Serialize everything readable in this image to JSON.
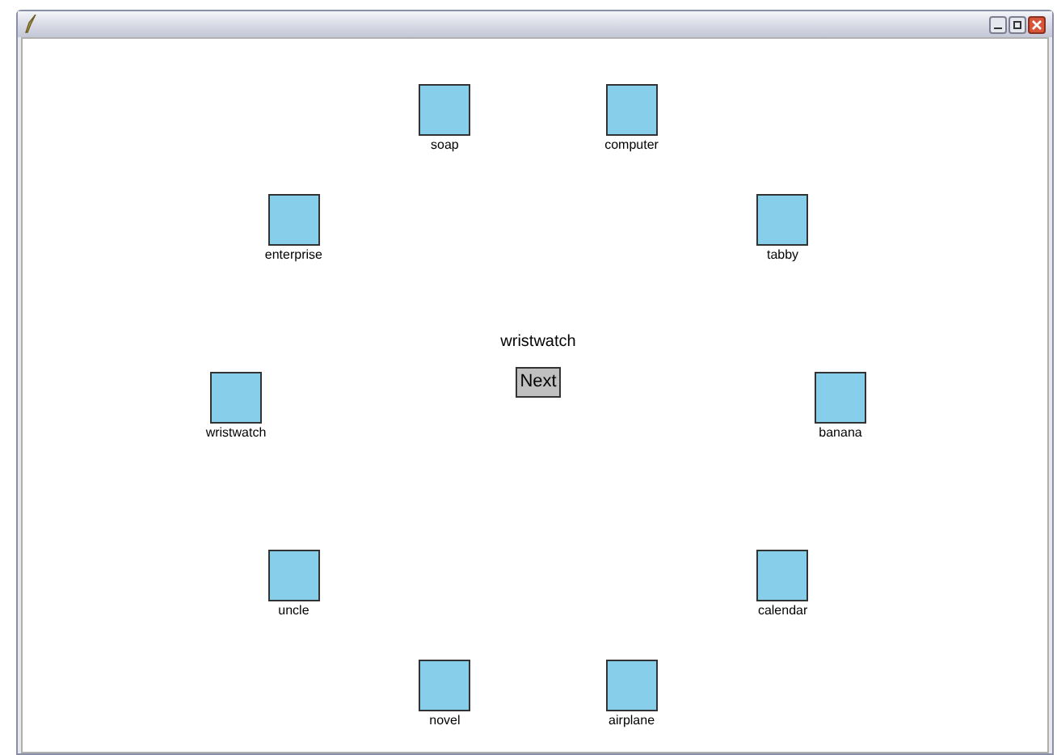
{
  "prompt": "wristwatch",
  "next_button": "Next",
  "items": [
    {
      "label": "soap"
    },
    {
      "label": "computer"
    },
    {
      "label": "enterprise"
    },
    {
      "label": "tabby"
    },
    {
      "label": "wristwatch"
    },
    {
      "label": "banana"
    },
    {
      "label": "uncle"
    },
    {
      "label": "calendar"
    },
    {
      "label": "novel"
    },
    {
      "label": "airplane"
    }
  ]
}
